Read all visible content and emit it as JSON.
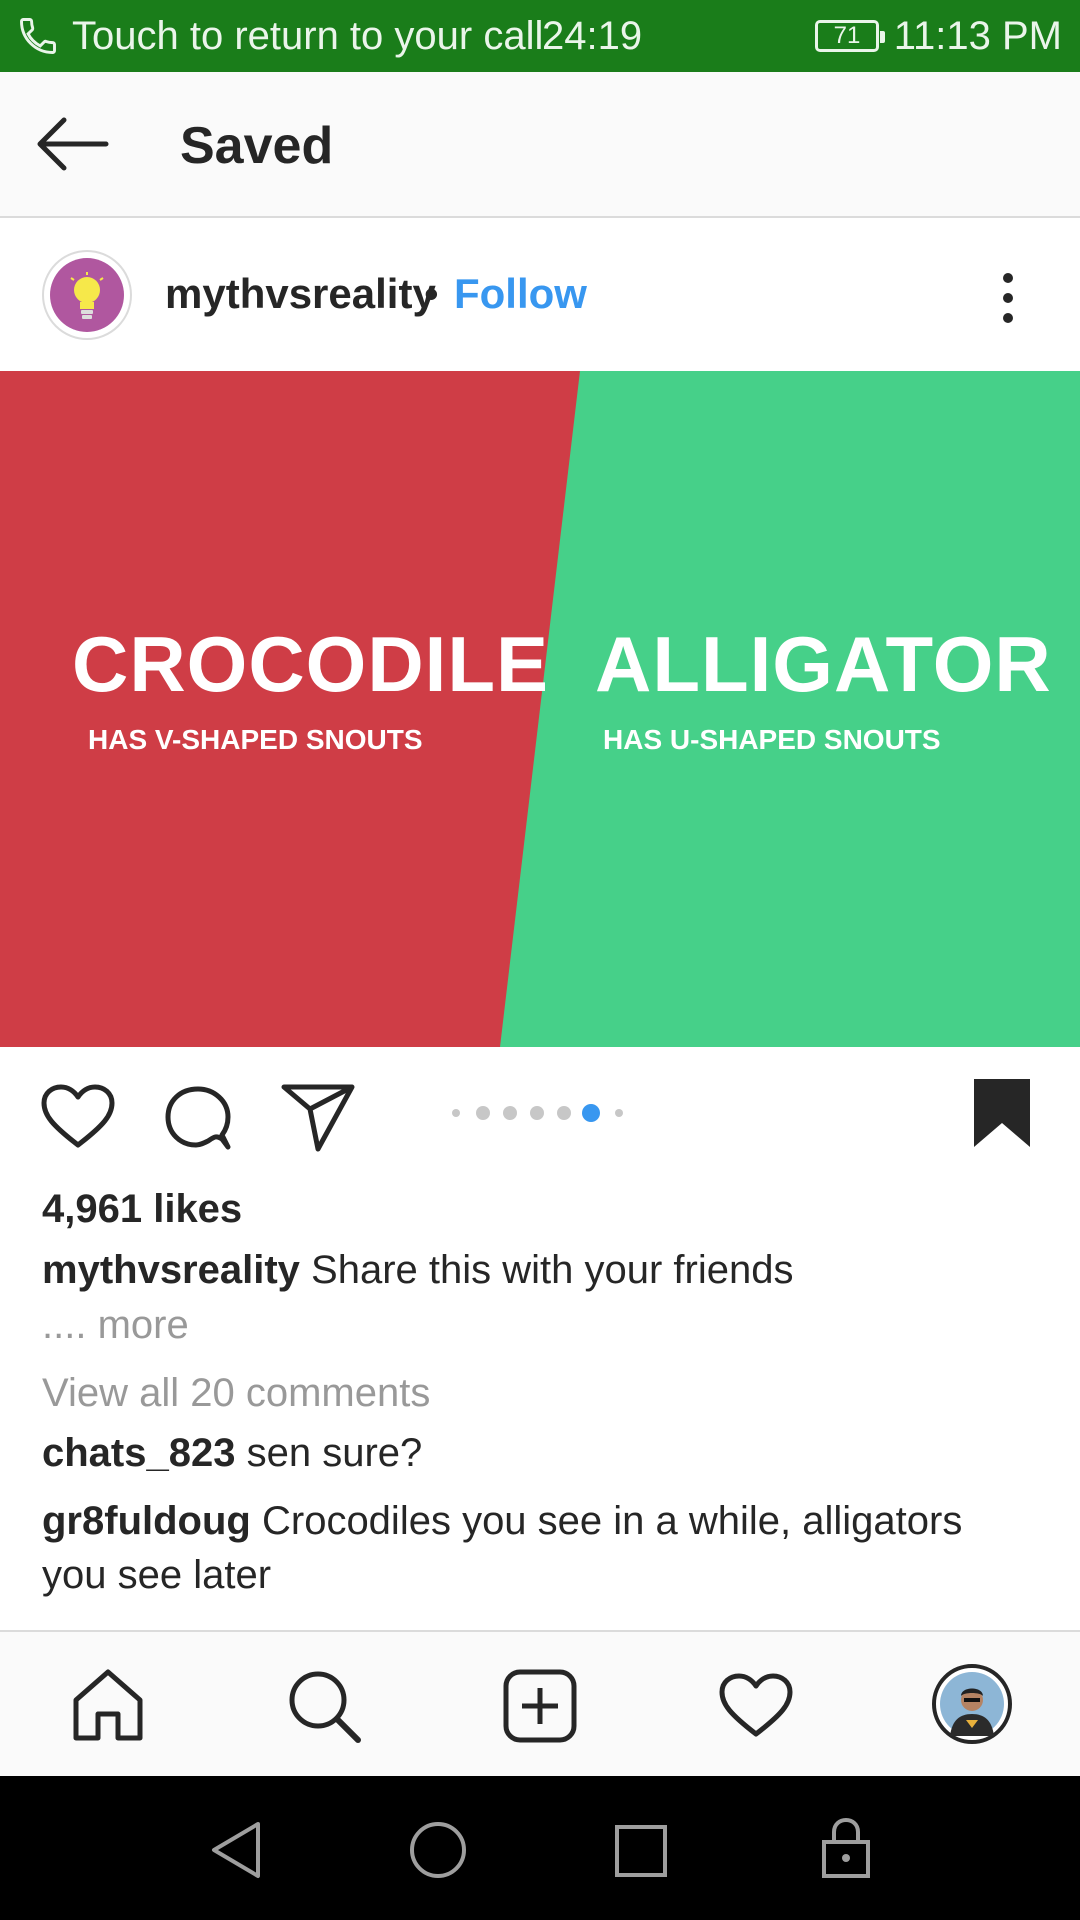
{
  "status_bar": {
    "call_text": "Touch to return to your call",
    "call_timer": "24:19",
    "battery": "71",
    "time": "11:13 PM"
  },
  "header": {
    "title": "Saved"
  },
  "post": {
    "username": "mythvsreality",
    "separator": "•",
    "follow_label": "Follow",
    "image": {
      "left_title": "CROCODILE",
      "left_subtitle": "HAS V-SHAPED SNOUTS",
      "right_title": "ALLIGATOR",
      "right_subtitle": "HAS U-SHAPED SNOUTS",
      "left_color": "#cf3d46",
      "right_color": "#46d089"
    },
    "carousel": {
      "total": 7,
      "active": 5
    },
    "likes": "4,961 likes",
    "caption_user": "mythvsreality",
    "caption_text": "Share this with your friends",
    "more_label": ".... more",
    "view_comments": "View all 20 comments",
    "comments": [
      {
        "user": "chats_823",
        "text": "sen sure?"
      },
      {
        "user": "gr8fuldoug",
        "text": "Crocodiles you see in a while, alligators",
        "text2": "you see later"
      }
    ]
  },
  "colors": {
    "status_bar": "#1a7d1a",
    "accent": "#3897f0",
    "avatar": "#b0579f"
  }
}
